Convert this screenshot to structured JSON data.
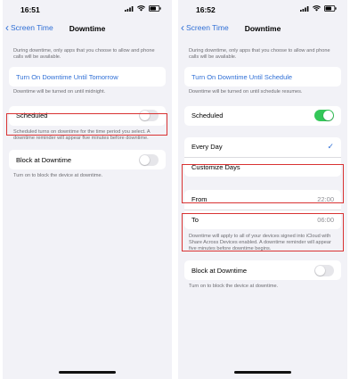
{
  "left": {
    "status": {
      "time": "16:51"
    },
    "nav": {
      "back_label": "Screen Time",
      "title": "Downtime"
    },
    "intro_text": "During downtime, only apps that you choose to allow and phone calls will be available.",
    "turn_on_label": "Turn On Downtime Until Tomorrow",
    "turn_on_note": "Downtime will be turned on until midnight.",
    "scheduled": {
      "label": "Scheduled",
      "on": false
    },
    "scheduled_note": "Scheduled turns on downtime for the time period you select. A downtime reminder will appear five minutes before downtime.",
    "block": {
      "label": "Block at Downtime",
      "on": false
    },
    "block_note": "Turn on to block the device at downtime."
  },
  "right": {
    "status": {
      "time": "16:52"
    },
    "nav": {
      "back_label": "Screen Time",
      "title": "Downtime"
    },
    "intro_text": "During downtime, only apps that you choose to allow and phone calls will be available.",
    "turn_on_label": "Turn On Downtime Until Schedule",
    "turn_on_note": "Downtime will be turned on until schedule resumes.",
    "scheduled": {
      "label": "Scheduled",
      "on": true
    },
    "days": {
      "every_day": "Every Day",
      "customize": "Customize Days",
      "selected": "Every Day"
    },
    "from": {
      "label": "From",
      "value": "22:00"
    },
    "to": {
      "label": "To",
      "value": "06:00"
    },
    "sync_note": "Downtime will apply to all of your devices signed into iCloud with Share Across Devices enabled. A downtime reminder will appear five minutes before downtime begins.",
    "block": {
      "label": "Block at Downtime",
      "on": false
    },
    "block_note": "Turn on to block the device at downtime."
  },
  "colors": {
    "accent": "#2f6fd6",
    "toggle_on": "#34c759",
    "highlight": "#d93333"
  }
}
